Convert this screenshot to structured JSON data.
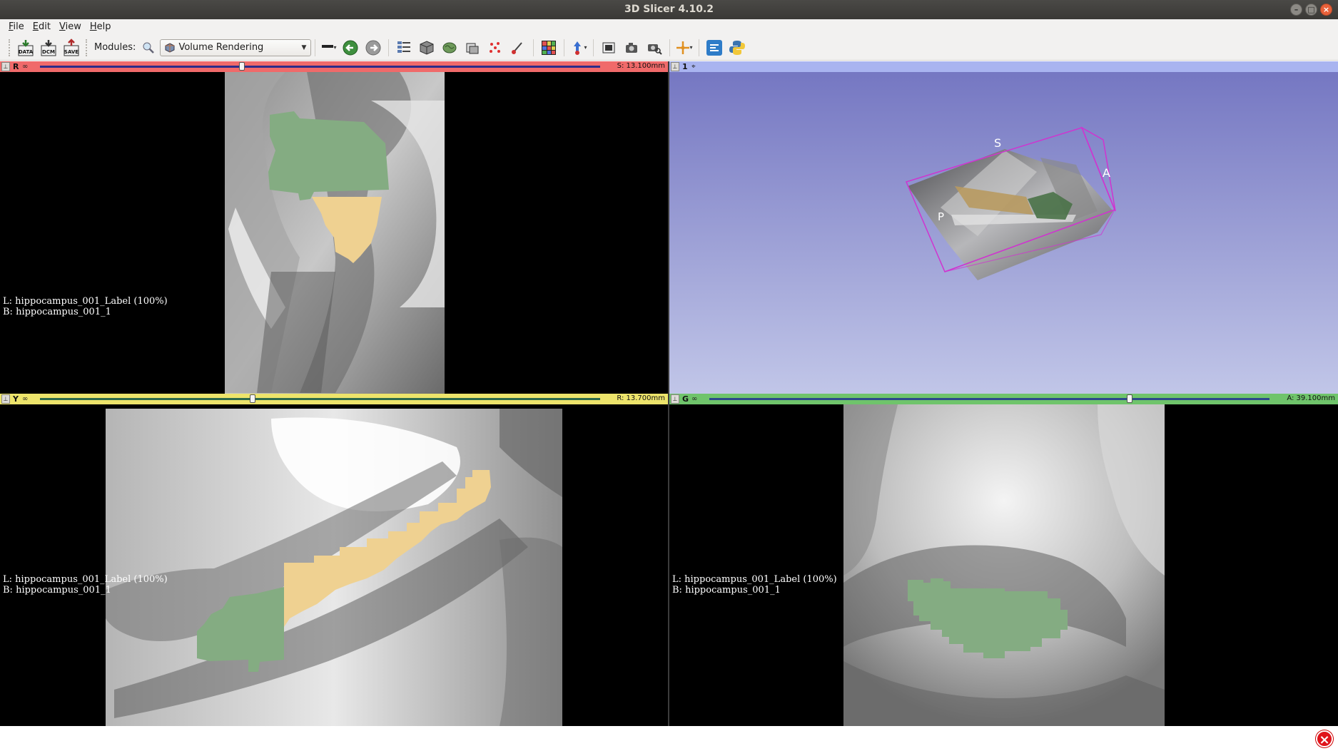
{
  "window": {
    "title": "3D Slicer 4.10.2"
  },
  "menu": {
    "items": [
      {
        "label": "File",
        "mnemonic": "F",
        "rest": "ile"
      },
      {
        "label": "Edit",
        "mnemonic": "E",
        "rest": "dit"
      },
      {
        "label": "View",
        "mnemonic": "V",
        "rest": "iew"
      },
      {
        "label": "Help",
        "mnemonic": "H",
        "rest": "elp"
      }
    ]
  },
  "toolbar": {
    "data_label": "DATA",
    "dcm_label": "DCM",
    "save_label": "SAVE",
    "modules_label": "Modules:",
    "module_selected": "Volume Rendering"
  },
  "views": {
    "red": {
      "label": "R",
      "color": "#f06a6a",
      "offset": "S: 13.100mm",
      "slider_fraction": 0.36,
      "label_line": "L: hippocampus_001_Label (100%)",
      "background_line": "B: hippocampus_001_1"
    },
    "threed": {
      "label": "1",
      "color": "#a9b4f0",
      "orientation_S": "S",
      "orientation_A": "A",
      "orientation_P": "P"
    },
    "yellow": {
      "label": "Y",
      "color": "#ede46b",
      "offset": "R: 13.700mm",
      "slider_fraction": 0.38,
      "label_line": "L: hippocampus_001_Label (100%)",
      "background_line": "B: hippocampus_001_1"
    },
    "green": {
      "label": "G",
      "color": "#6fc46b",
      "offset": "A: 39.100mm",
      "slider_fraction": 0.75,
      "label_line": "L: hippocampus_001_Label (100%)",
      "background_line": "B: hippocampus_001_1"
    }
  },
  "colors": {
    "label_green": "#84ac82",
    "label_tan": "#efd191",
    "bbox_magenta": "#d033d0"
  }
}
